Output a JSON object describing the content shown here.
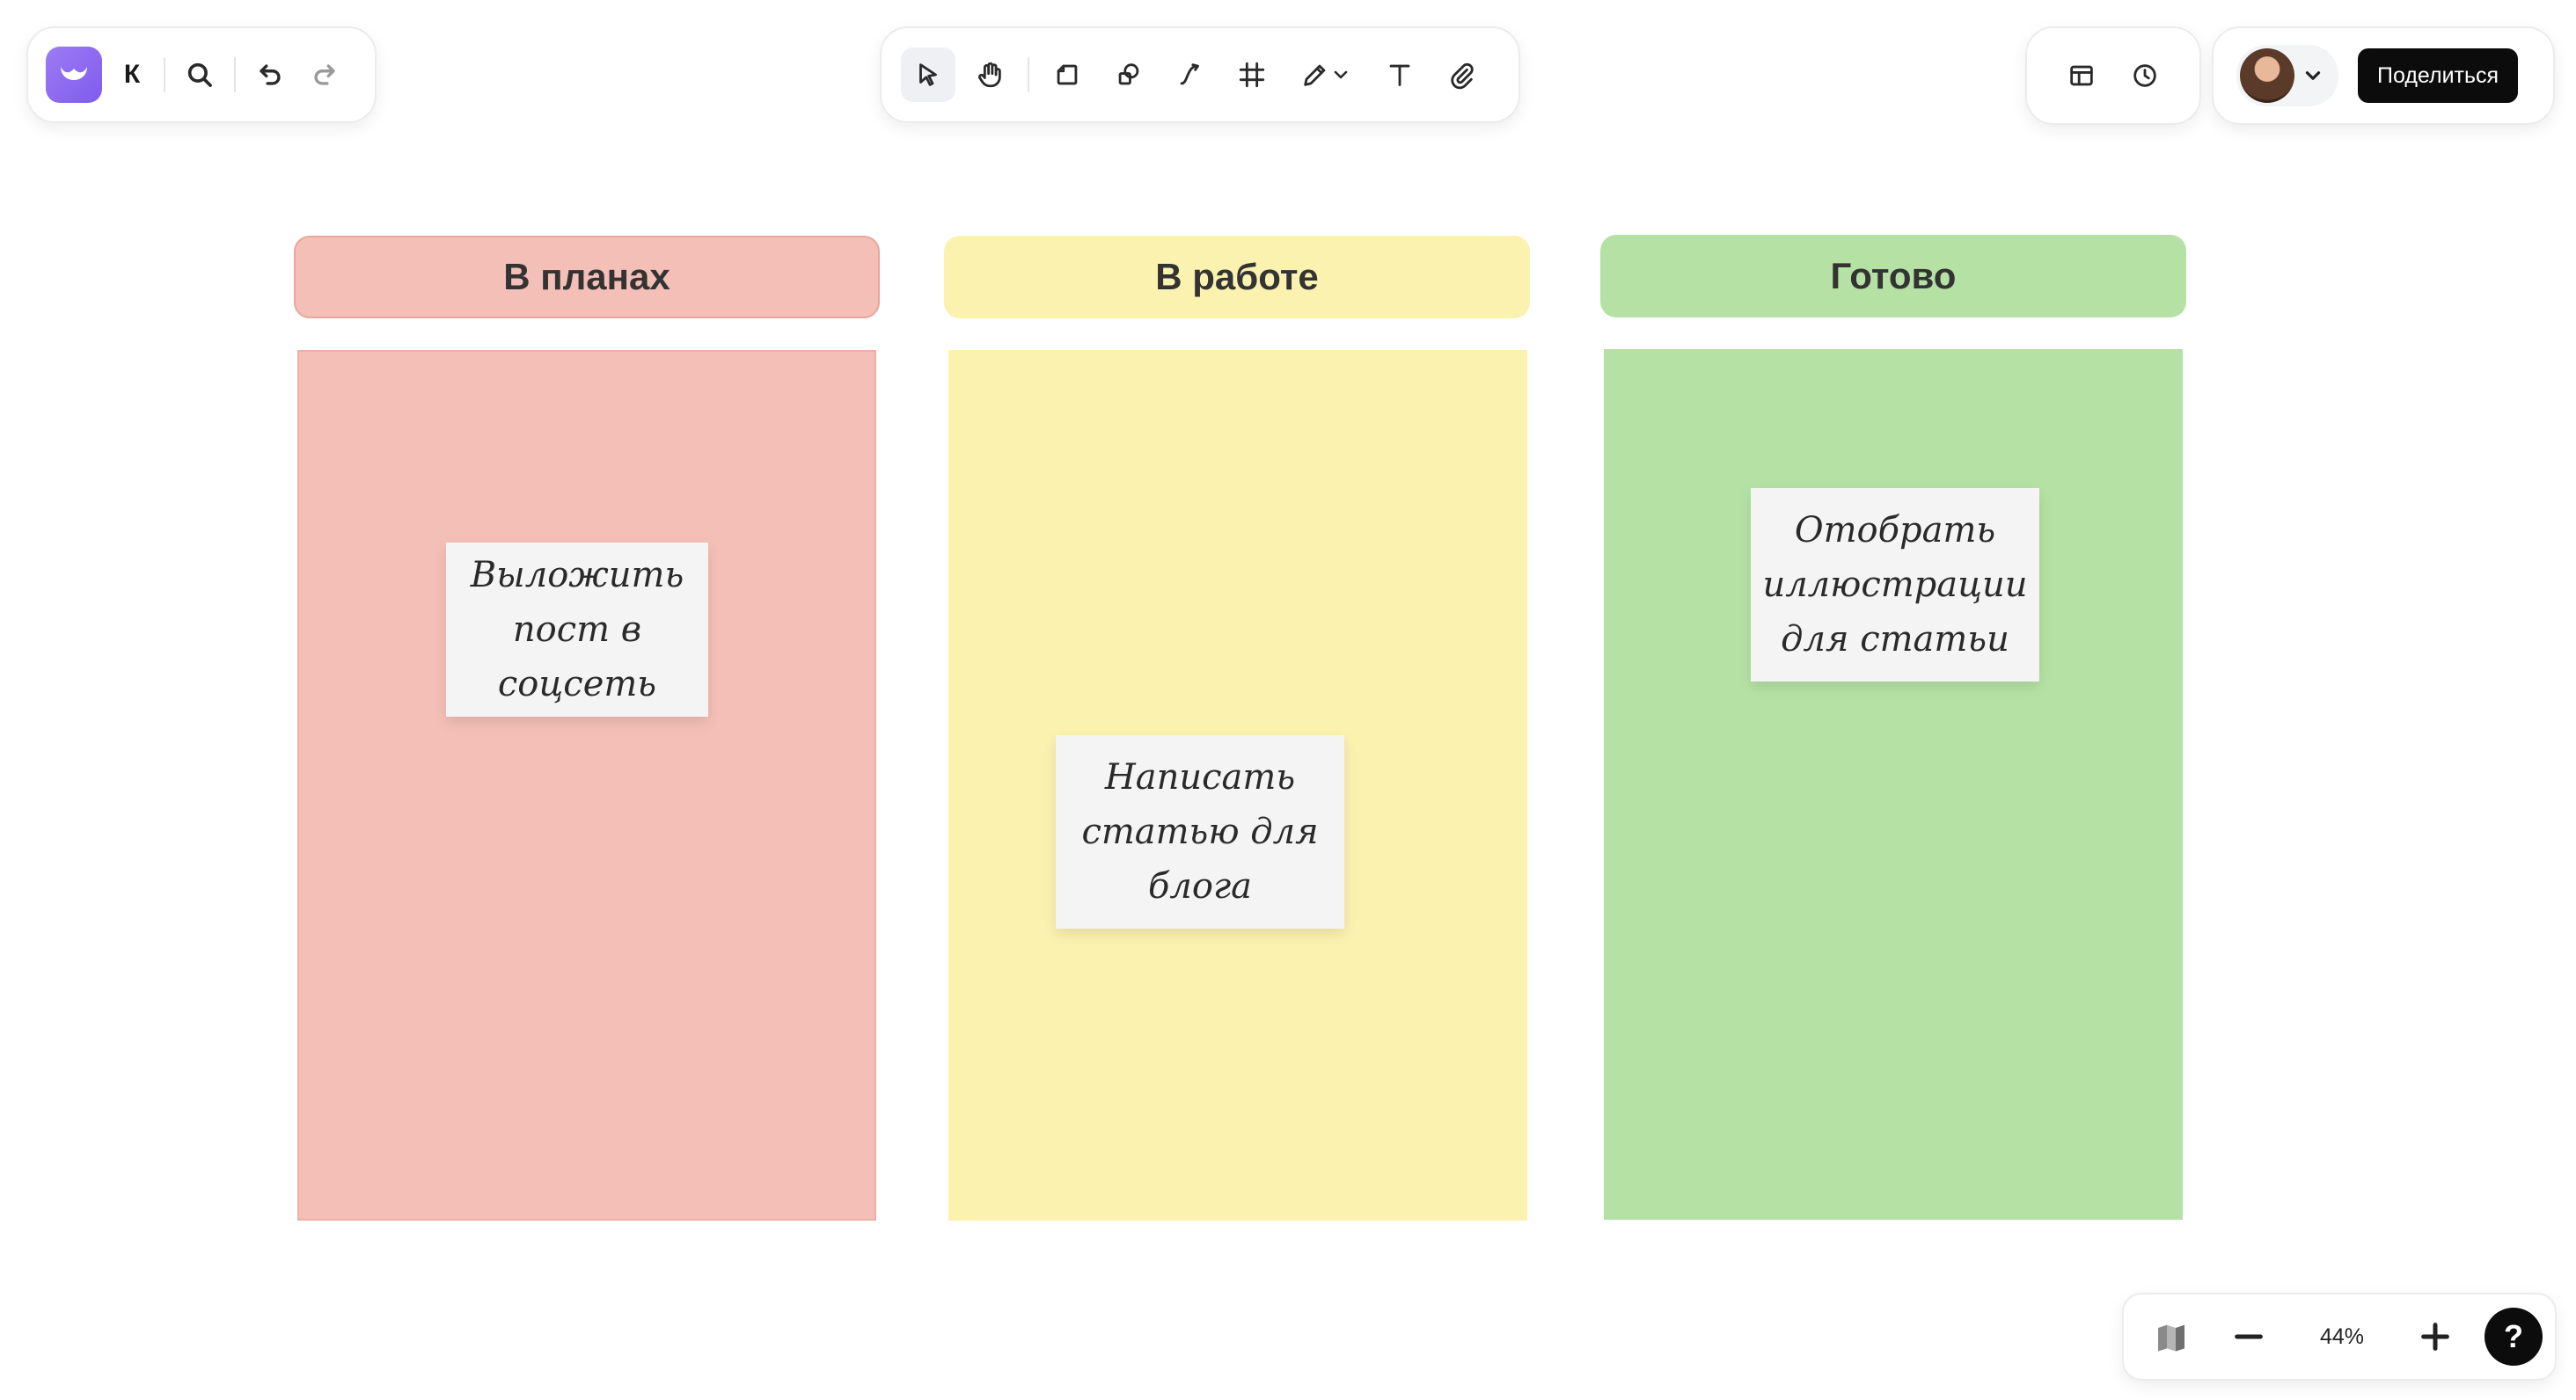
{
  "board": {
    "initial": "К"
  },
  "toolbar": {
    "tools": [
      {
        "id": "select",
        "icon": "cursor-icon",
        "active": true
      },
      {
        "id": "hand",
        "icon": "hand-icon"
      },
      {
        "id": "sticker",
        "icon": "sticky-note-icon"
      },
      {
        "id": "shapes",
        "icon": "shapes-icon"
      },
      {
        "id": "connector",
        "icon": "connector-icon"
      },
      {
        "id": "frame",
        "icon": "frame-icon"
      },
      {
        "id": "pen",
        "icon": "pen-icon"
      },
      {
        "id": "text",
        "icon": "text-icon"
      },
      {
        "id": "attach",
        "icon": "paperclip-icon"
      }
    ]
  },
  "header": {
    "share_label": "Поделиться"
  },
  "columns": [
    {
      "id": "plan",
      "title": "В планах",
      "color": "#f4bfb6"
    },
    {
      "id": "work",
      "title": "В работе",
      "color": "#fbf2b0"
    },
    {
      "id": "done",
      "title": "Готово",
      "color": "#b5e2a4"
    }
  ],
  "stickers": [
    {
      "column": "plan",
      "lines": [
        "Выложить",
        "пост в",
        "соцсеть"
      ]
    },
    {
      "column": "work",
      "lines": [
        "Написать",
        "статью для",
        "блога"
      ]
    },
    {
      "column": "done",
      "lines": [
        "Отобрать",
        "иллюстрации",
        "для статьи"
      ]
    }
  ],
  "zoom": {
    "level": "44%",
    "help_label": "?"
  }
}
